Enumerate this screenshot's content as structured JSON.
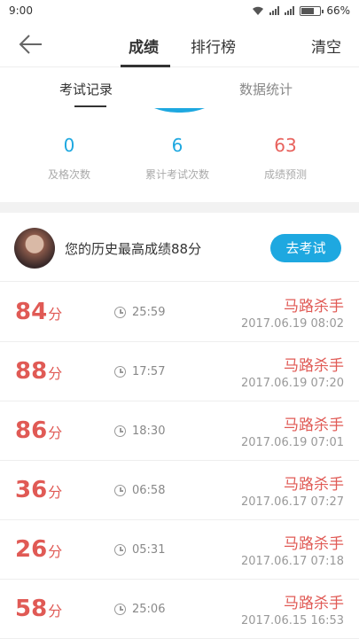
{
  "status": {
    "time": "9:00",
    "battery": "66%",
    "battery_level": 0.66
  },
  "nav": {
    "tabs": [
      "成绩",
      "排行榜"
    ],
    "active_tab": "成绩",
    "action": "清空"
  },
  "subtabs": {
    "items": [
      "考试记录",
      "数据统计"
    ],
    "active": "考试记录"
  },
  "stats": [
    {
      "value": "0",
      "label": "及格次数"
    },
    {
      "value": "6",
      "label": "累计考试次数"
    },
    {
      "value": "63",
      "label": "成绩预测"
    }
  ],
  "best": {
    "text": "您的历史最高成绩88分",
    "button": "去考试"
  },
  "score_unit": "分",
  "records": [
    {
      "score": "84",
      "duration": "25:59",
      "name": "马路杀手",
      "date": "2017.06.19  08:02"
    },
    {
      "score": "88",
      "duration": "17:57",
      "name": "马路杀手",
      "date": "2017.06.19  07:20"
    },
    {
      "score": "86",
      "duration": "18:30",
      "name": "马路杀手",
      "date": "2017.06.19  07:01"
    },
    {
      "score": "36",
      "duration": "06:58",
      "name": "马路杀手",
      "date": "2017.06.17  07:27"
    },
    {
      "score": "26",
      "duration": "05:31",
      "name": "马路杀手",
      "date": "2017.06.17  07:18"
    },
    {
      "score": "58",
      "duration": "25:06",
      "name": "马路杀手",
      "date": "2017.06.15  16:53"
    }
  ],
  "colors": {
    "accent": "#1ea8e0",
    "score": "#e05a55"
  }
}
